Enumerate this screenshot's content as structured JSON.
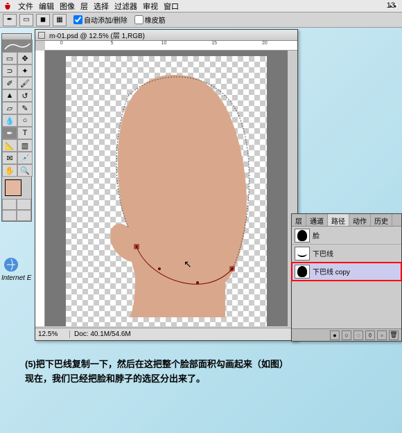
{
  "menubar": {
    "items": [
      "文件",
      "编辑",
      "图像",
      "层",
      "选择",
      "过滤器",
      "审视",
      "窗口"
    ],
    "page_num": "13"
  },
  "toolbar": {
    "auto_add_delete": "自动添加/删除",
    "rubber_band": "橡皮筋"
  },
  "document": {
    "title": "m-01.psd @ 12.5% (层 1,RGB)",
    "zoom": "12.5%",
    "doc_info": "Doc: 40.1M/54.6M",
    "ruler_marks": [
      "0",
      "5",
      "10",
      "15",
      "20"
    ]
  },
  "paths_panel": {
    "tabs": [
      "层",
      "通道",
      "路径",
      "动作",
      "历史"
    ],
    "active_tab": 2,
    "items": [
      {
        "name": "脸"
      },
      {
        "name": "下巴线"
      },
      {
        "name": "下巴线 copy"
      }
    ],
    "selected": 2
  },
  "internet": "Internet E",
  "caption": {
    "line1": "(5)把下巴线复制一下，然后在这把整个脸部面积勾画起来（如图）",
    "line2": "现在，我们已经把脸和脖子的选区分出来了。"
  },
  "colors": {
    "skin": "#d9a88c",
    "skin_dark": "#c89578"
  }
}
